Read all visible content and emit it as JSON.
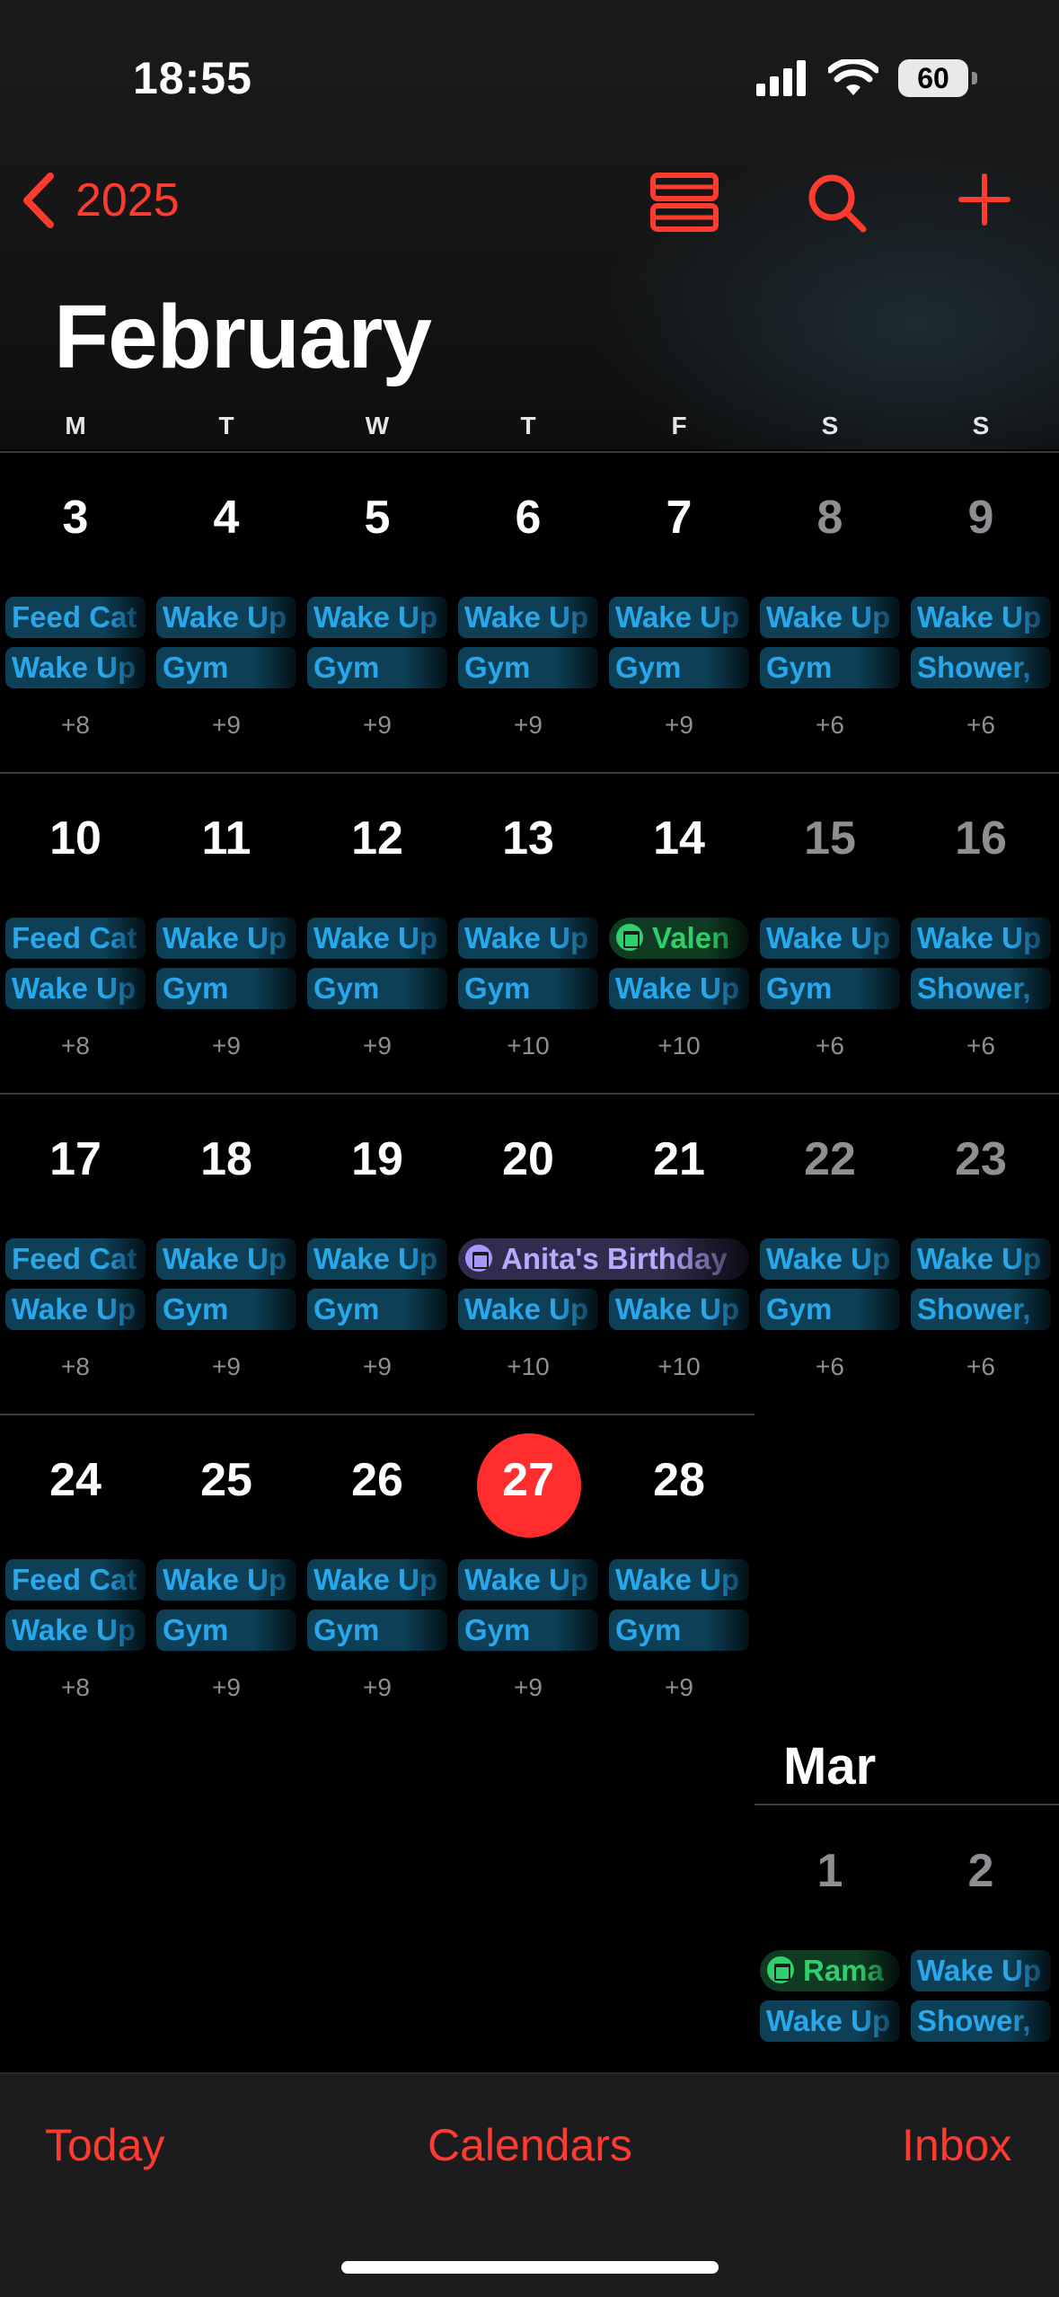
{
  "status_bar": {
    "time": "18:55",
    "battery": "60"
  },
  "nav": {
    "back_label": "2025"
  },
  "month_title": "February",
  "weekdays": [
    "M",
    "T",
    "W",
    "T",
    "F",
    "S",
    "S"
  ],
  "weeks": [
    {
      "days": [
        {
          "num": "3",
          "e1": "Feed Cat",
          "e2": "Wake Up",
          "more": "+8"
        },
        {
          "num": "4",
          "e1": "Wake Up",
          "e2": "Gym",
          "more": "+9"
        },
        {
          "num": "5",
          "e1": "Wake Up",
          "e2": "Gym",
          "more": "+9"
        },
        {
          "num": "6",
          "e1": "Wake Up",
          "e2": "Gym",
          "more": "+9"
        },
        {
          "num": "7",
          "e1": "Wake Up",
          "e2": "Gym",
          "more": "+9"
        },
        {
          "num": "8",
          "e1": "Wake Up",
          "e2": "Gym",
          "more": "+6"
        },
        {
          "num": "9",
          "e1": "Wake Up",
          "e2": "Shower,",
          "more": "+6"
        }
      ]
    },
    {
      "days": [
        {
          "num": "10",
          "e1": "Feed Cat",
          "e2": "Wake Up",
          "more": "+8"
        },
        {
          "num": "11",
          "e1": "Wake Up",
          "e2": "Gym",
          "more": "+9"
        },
        {
          "num": "12",
          "e1": "Wake Up",
          "e2": "Gym",
          "more": "+9"
        },
        {
          "num": "13",
          "e1": "Wake Up",
          "e2": "Gym",
          "more": "+10"
        },
        {
          "num": "14",
          "e1": "Valen",
          "e2": "Wake Up",
          "more": "+10"
        },
        {
          "num": "15",
          "e1": "Wake Up",
          "e2": "Gym",
          "more": "+6"
        },
        {
          "num": "16",
          "e1": "Wake Up",
          "e2": "Shower,",
          "more": "+6"
        }
      ]
    },
    {
      "days": [
        {
          "num": "17",
          "e1": "Feed Cat",
          "e2": "Wake Up",
          "more": "+8"
        },
        {
          "num": "18",
          "e1": "Wake Up",
          "e2": "Gym",
          "more": "+9"
        },
        {
          "num": "19",
          "e1": "Wake Up",
          "e2": "Gym",
          "more": "+9"
        },
        {
          "num": "20",
          "e1": "Anita's Birthday",
          "e2": "Wake Up",
          "more": "+10"
        },
        {
          "num": "21",
          "e1": "",
          "e2": "Wake Up",
          "more": "+10"
        },
        {
          "num": "22",
          "e1": "Wake Up",
          "e2": "Gym",
          "more": "+6"
        },
        {
          "num": "23",
          "e1": "Wake Up",
          "e2": "Shower,",
          "more": "+6"
        }
      ]
    },
    {
      "days": [
        {
          "num": "24",
          "e1": "Feed Cat",
          "e2": "Wake Up",
          "more": "+8"
        },
        {
          "num": "25",
          "e1": "Wake Up",
          "e2": "Gym",
          "more": "+9"
        },
        {
          "num": "26",
          "e1": "Wake Up",
          "e2": "Gym",
          "more": "+9"
        },
        {
          "num": "27",
          "e1": "Wake Up",
          "e2": "Gym",
          "more": "+9"
        },
        {
          "num": "28",
          "e1": "Wake Up",
          "e2": "Gym",
          "more": "+9"
        }
      ]
    }
  ],
  "march": {
    "label": "Mar",
    "days": [
      {
        "num": "1",
        "e1": "Rama",
        "e2": "Wake Up"
      },
      {
        "num": "2",
        "e1": "Wake Up",
        "e2": "Shower,"
      }
    ]
  },
  "tab_bar": {
    "today": "Today",
    "calendars": "Calendars",
    "inbox": "Inbox"
  },
  "colors": {
    "accent": "#ff3b30",
    "today_circle": "#ff2d2d",
    "event_blue": "#28a7ea",
    "event_green": "#2fcf6d",
    "event_purple": "#b9a9ff"
  }
}
